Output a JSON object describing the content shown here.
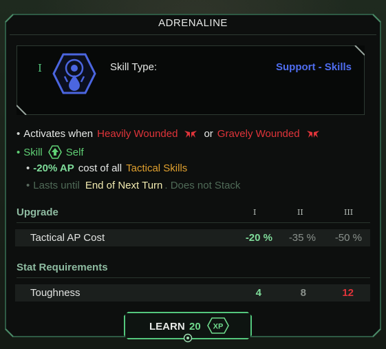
{
  "title": "ADRENALINE",
  "skill": {
    "tier": "I",
    "icon": "adrenaline-drop-icon",
    "type_label": "Skill Type:",
    "type_value": "Support - Skills"
  },
  "effects": {
    "line1": {
      "prefix": "Activates when",
      "cond1": "Heavily Wounded",
      "connector": "or",
      "cond2": "Gravely Wounded"
    },
    "line2": {
      "skill": "Skill",
      "target": "Self"
    },
    "line3": {
      "amount": "-20% AP",
      "middle": "cost of all",
      "target": "Tactical Skills"
    },
    "line4": {
      "prefix": "Lasts until",
      "duration": "End of Next Turn",
      "suffix": ". Does not Stack"
    }
  },
  "upgrade": {
    "header": "Upgrade",
    "columns": [
      "I",
      "II",
      "III"
    ],
    "row": {
      "name": "Tactical AP Cost",
      "values": [
        "-20 %",
        "-35 %",
        "-50 %"
      ]
    }
  },
  "requirements": {
    "header": "Stat Requirements",
    "row": {
      "name": "Toughness",
      "values": [
        "4",
        "8",
        "12"
      ]
    }
  },
  "learn": {
    "label": "LEARN",
    "cost": "20",
    "currency": "XP"
  },
  "colors": {
    "accent_green": "#54c77d",
    "skill_type_blue": "#4f6df0",
    "wound_red": "#e0343a",
    "tactical_orange": "#e0a02e"
  }
}
